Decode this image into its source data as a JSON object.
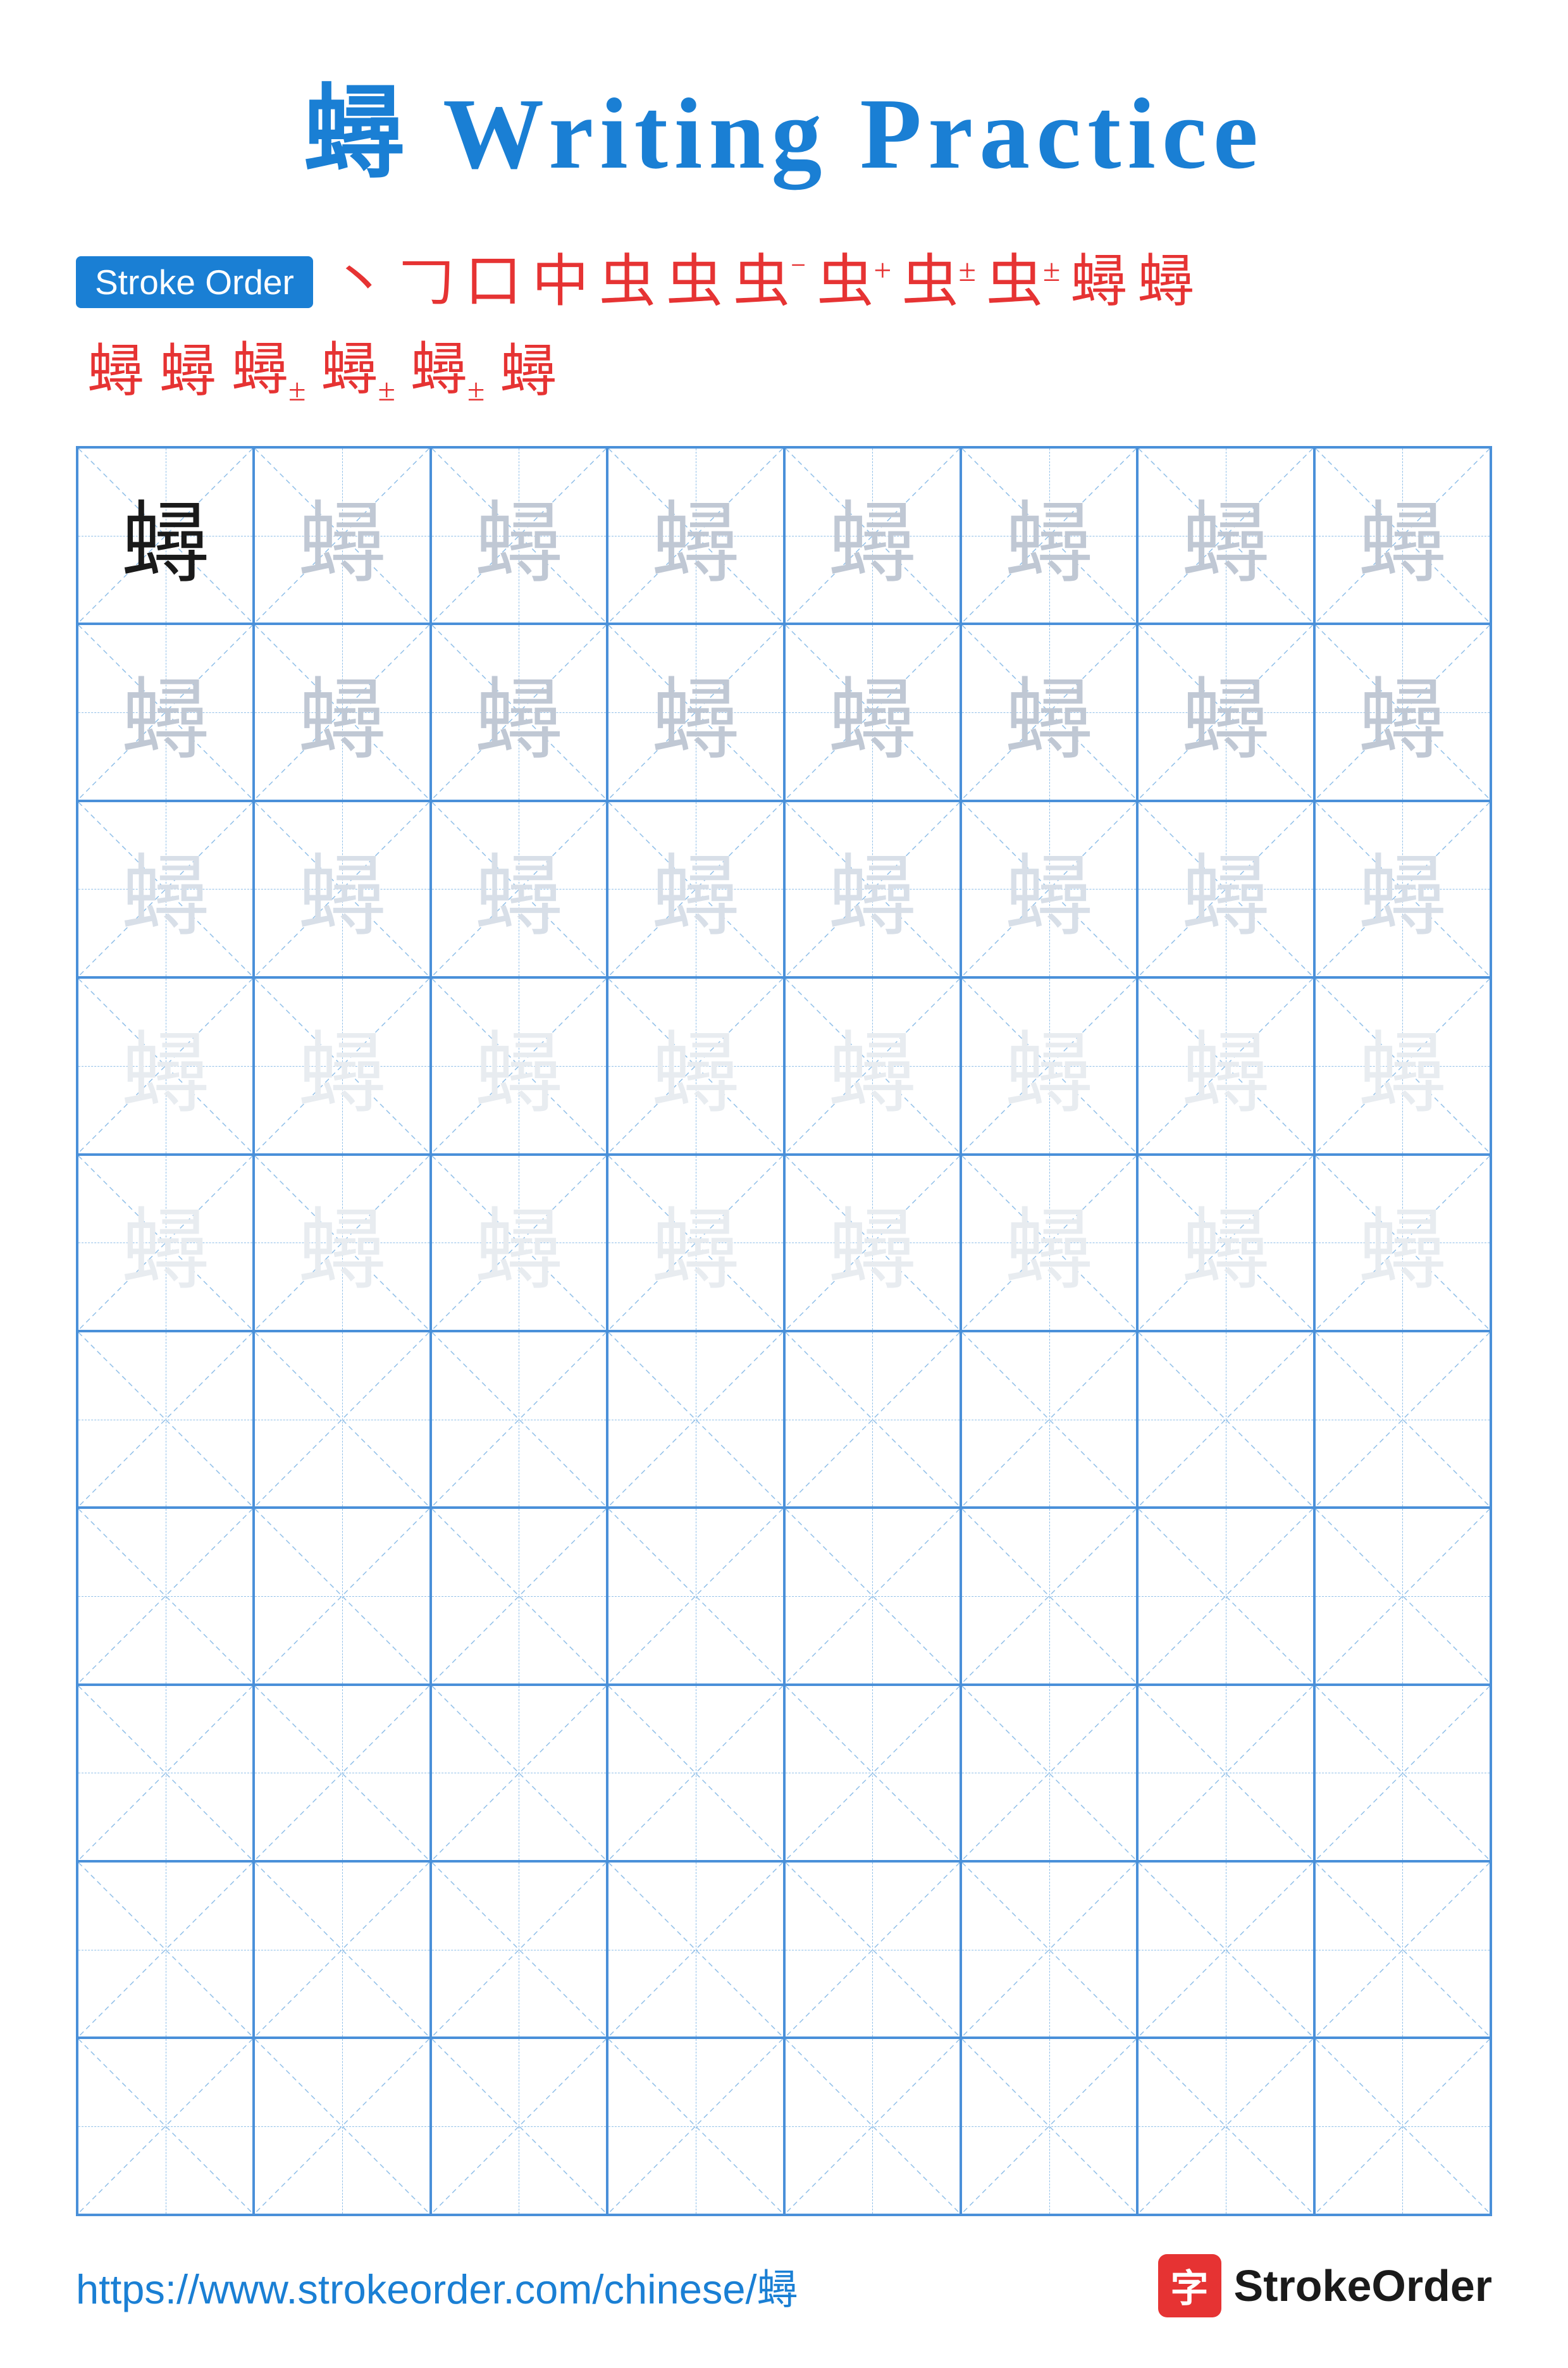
{
  "title": {
    "char": "蟳",
    "text": " Writing Practice",
    "full": "蟳 Writing Practice"
  },
  "stroke_order": {
    "badge_label": "Stroke Order",
    "steps_row1": [
      "丶",
      "𠃌",
      "口",
      "中",
      "虫",
      "虫",
      "虫⁻",
      "虫⁺",
      "虫±",
      "虫±",
      "蟳",
      "蟳"
    ],
    "steps_row2": [
      "蟳",
      "蟳",
      "蟳±",
      "蟳±",
      "蟳±",
      "蟳"
    ]
  },
  "grid": {
    "rows": 10,
    "cols": 8,
    "char": "蟳",
    "practice_char": "蟳"
  },
  "footer": {
    "url": "https://www.strokeorder.com/chinese/蟳",
    "brand": "StrokeOrder"
  },
  "colors": {
    "blue": "#1a7fd4",
    "red": "#e63333",
    "dark": "#1a1a1a",
    "medium": "#b0bcc8",
    "light": "#cdd5de",
    "vlight": "#dde3ea"
  }
}
